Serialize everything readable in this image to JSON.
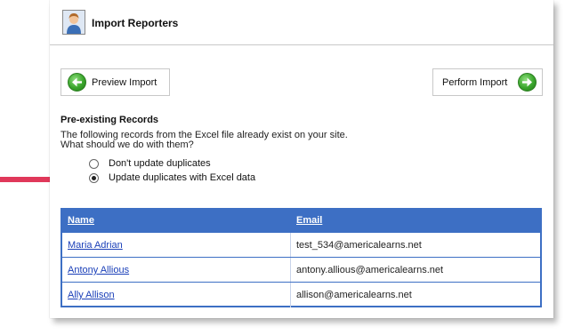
{
  "header": {
    "title": "Import Reporters",
    "icon": "reporter-avatar-icon"
  },
  "actions": {
    "preview_label": "Preview Import",
    "preview_icon": "arrow-left-circle-icon",
    "perform_label": "Perform Import",
    "perform_icon": "arrow-right-circle-icon"
  },
  "section": {
    "title": "Pre-existing Records",
    "description_line1": "The following records from the Excel file already exist on your site.",
    "description_line2": "What should we do with them?"
  },
  "options": [
    {
      "label": "Don't update duplicates",
      "selected": false
    },
    {
      "label": "Update duplicates with Excel data",
      "selected": true
    }
  ],
  "table": {
    "columns": [
      "Name",
      "Email"
    ],
    "rows": [
      {
        "name": "Maria Adrian",
        "email": "test_534@americalearns.net"
      },
      {
        "name": "Antony Allious",
        "email": "antony.allious@americalearns.net"
      },
      {
        "name": "Ally Allison",
        "email": "allison@americalearns.net"
      }
    ]
  },
  "colors": {
    "table_header": "#3d6fc4",
    "link": "#1a3fb8",
    "annotation_arrow": "#e0385a",
    "button_icon": "#3aa52c"
  }
}
